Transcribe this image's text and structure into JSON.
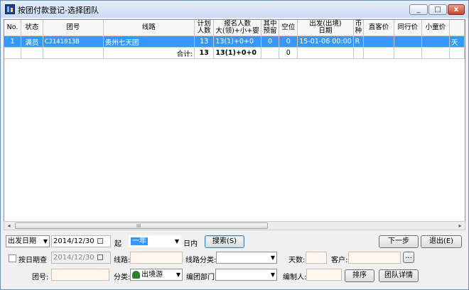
{
  "window": {
    "title": "按团付款登记-选择团队",
    "controls": [
      "_",
      "□",
      "x"
    ]
  },
  "grid": {
    "columns": [
      {
        "label": "No."
      },
      {
        "label": "状态"
      },
      {
        "label": "团号"
      },
      {
        "label": "线路"
      },
      {
        "label": "计划\n人数"
      },
      {
        "label": "报名人数\n大(领)+小+婴"
      },
      {
        "label": "其中\n预留"
      },
      {
        "label": "空位"
      },
      {
        "label": "出发(出境)\n日期"
      },
      {
        "label": "币\n种"
      },
      {
        "label": "直客价"
      },
      {
        "label": "同行价"
      },
      {
        "label": "小童价"
      },
      {
        "label": ""
      }
    ],
    "rows": [
      {
        "no": "1",
        "status": "满员",
        "group_no": "CJ141013B",
        "route": "贵州七天团",
        "planned": "13",
        "registered": "13(1)+0+0",
        "reserved": "0",
        "vacancy": "0",
        "depart": "15-01-06 00:00",
        "currency": "R",
        "direct_price": "",
        "peer_price": "",
        "child_price": "",
        "extra": "天"
      }
    ],
    "totals": {
      "label": "合计:",
      "planned": "13",
      "registered": "13(1)+0+0",
      "vacancy": "0"
    }
  },
  "scrollbar": {
    "left": "◂",
    "grip": "III",
    "right": "▸"
  },
  "filters": {
    "date_type": "出发日期",
    "start_date": "2014/12/30",
    "start_label": "起",
    "range": "一年",
    "within_label": "日内",
    "search_button": "搜索(S)",
    "by_date_label": "按日期查",
    "by_date_value": "2014/12/30",
    "route_label": "线路:",
    "route_value": "",
    "route_cat_label": "线路分类:",
    "route_cat_value": "",
    "days_label": "天数:",
    "days_value": "",
    "client_label": "客户:",
    "client_value": "",
    "browse_button": "...",
    "group_no_label": "团号:",
    "group_no_value": "",
    "category_label": "分类:",
    "category_value": "出境游",
    "dept_label": "编团部门:",
    "dept_value": "",
    "compiler_label": "编制人:",
    "compiler_value": ""
  },
  "buttons": {
    "next": "下一步",
    "exit": "退出(E)",
    "sort": "排序",
    "group_detail": "团队详情"
  }
}
